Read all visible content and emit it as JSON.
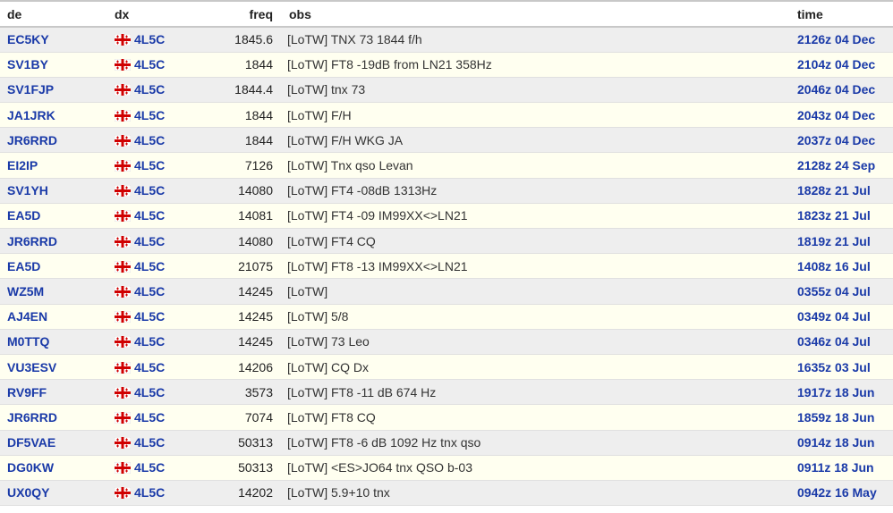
{
  "columns": {
    "de": "de",
    "dx": "dx",
    "freq": "freq",
    "obs": "obs",
    "time": "time"
  },
  "colors": {
    "link": "#1a3aa8",
    "row_odd": "#eeeeee",
    "row_even": "#fffff0",
    "flag_red": "#d00000"
  },
  "flag_icon": "georgia-flag-icon",
  "rows": [
    {
      "de": "EC5KY",
      "dx": "4L5C",
      "freq": "1845.6",
      "obs": "[LoTW] TNX 73 1844 f/h",
      "time": "2126z 04 Dec"
    },
    {
      "de": "SV1BY",
      "dx": "4L5C",
      "freq": "1844",
      "obs": "[LoTW] FT8 -19dB from LN21 358Hz",
      "time": "2104z 04 Dec"
    },
    {
      "de": "SV1FJP",
      "dx": "4L5C",
      "freq": "1844.4",
      "obs": "[LoTW] tnx 73",
      "time": "2046z 04 Dec"
    },
    {
      "de": "JA1JRK",
      "dx": "4L5C",
      "freq": "1844",
      "obs": "[LoTW] F/H",
      "time": "2043z 04 Dec"
    },
    {
      "de": "JR6RRD",
      "dx": "4L5C",
      "freq": "1844",
      "obs": "[LoTW] F/H WKG JA",
      "time": "2037z 04 Dec"
    },
    {
      "de": "EI2IP",
      "dx": "4L5C",
      "freq": "7126",
      "obs": "[LoTW] Tnx qso Levan",
      "time": "2128z 24 Sep"
    },
    {
      "de": "SV1YH",
      "dx": "4L5C",
      "freq": "14080",
      "obs": "[LoTW] FT4 -08dB 1313Hz",
      "time": "1828z 21 Jul"
    },
    {
      "de": "EA5D",
      "dx": "4L5C",
      "freq": "14081",
      "obs": "[LoTW] FT4 -09 IM99XX<>LN21",
      "time": "1823z 21 Jul"
    },
    {
      "de": "JR6RRD",
      "dx": "4L5C",
      "freq": "14080",
      "obs": "[LoTW] FT4 CQ",
      "time": "1819z 21 Jul"
    },
    {
      "de": "EA5D",
      "dx": "4L5C",
      "freq": "21075",
      "obs": "[LoTW] FT8 -13 IM99XX<>LN21",
      "time": "1408z 16 Jul"
    },
    {
      "de": "WZ5M",
      "dx": "4L5C",
      "freq": "14245",
      "obs": "[LoTW]",
      "time": "0355z 04 Jul"
    },
    {
      "de": "AJ4EN",
      "dx": "4L5C",
      "freq": "14245",
      "obs": "[LoTW] 5/8",
      "time": "0349z 04 Jul"
    },
    {
      "de": "M0TTQ",
      "dx": "4L5C",
      "freq": "14245",
      "obs": "[LoTW] 73 Leo",
      "time": "0346z 04 Jul"
    },
    {
      "de": "VU3ESV",
      "dx": "4L5C",
      "freq": "14206",
      "obs": "[LoTW] CQ Dx",
      "time": "1635z 03 Jul"
    },
    {
      "de": "RV9FF",
      "dx": "4L5C",
      "freq": "3573",
      "obs": "[LoTW] FT8 -11 dB 674 Hz",
      "time": "1917z 18 Jun"
    },
    {
      "de": "JR6RRD",
      "dx": "4L5C",
      "freq": "7074",
      "obs": "[LoTW] FT8 CQ",
      "time": "1859z 18 Jun"
    },
    {
      "de": "DF5VAE",
      "dx": "4L5C",
      "freq": "50313",
      "obs": "[LoTW] FT8 -6 dB 1092 Hz tnx qso",
      "time": "0914z 18 Jun"
    },
    {
      "de": "DG0KW",
      "dx": "4L5C",
      "freq": "50313",
      "obs": "[LoTW] <ES>JO64 tnx QSO b-03",
      "time": "0911z 18 Jun"
    },
    {
      "de": "UX0QY",
      "dx": "4L5C",
      "freq": "14202",
      "obs": "[LoTW] 5.9+10 tnx",
      "time": "0942z 16 May"
    }
  ]
}
